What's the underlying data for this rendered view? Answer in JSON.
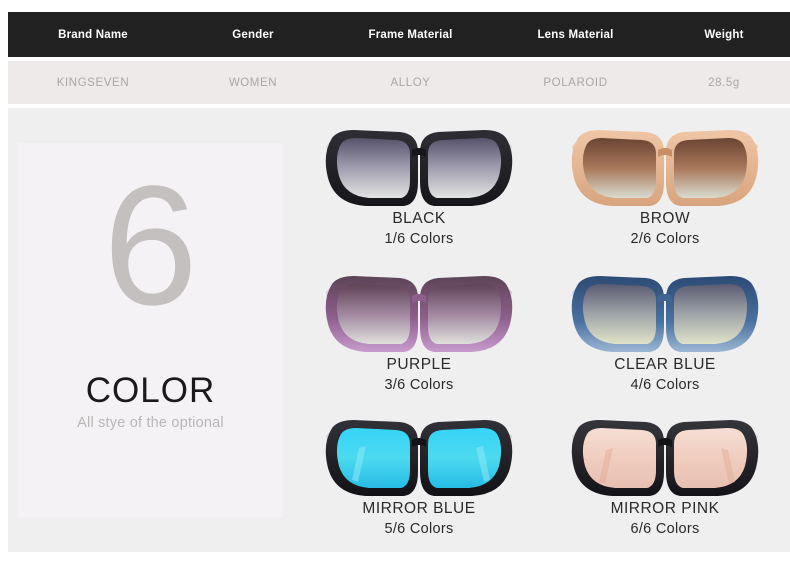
{
  "spec_table": {
    "headers": [
      "Brand Name",
      "Gender",
      "Frame Material",
      "Lens Material",
      "Weight"
    ],
    "values": [
      "KINGSEVEN",
      "WOMEN",
      "ALLOY",
      "POLAROID",
      "28.5g"
    ]
  },
  "color_panel": {
    "count": "6",
    "title": "COLOR",
    "subtitle": "All stye of the optional"
  },
  "products": [
    {
      "name": "BLACK",
      "count": "1/6  Colors",
      "frame_color": "#16161a",
      "frame_color_2": "#2e2e34",
      "lens_top": "#55526b",
      "lens_mid": "#9a97aa",
      "lens_bottom": "#e2e3e2",
      "temple_color": "#3a3a40"
    },
    {
      "name": "BROW",
      "count": "2/6  Colors",
      "frame_color": "#e8b997",
      "frame_color_2": "#d8a47e",
      "lens_top": "#6a4433",
      "lens_mid": "#a9775a",
      "lens_bottom": "#d9dccf",
      "temple_color": "#8d5b43"
    },
    {
      "name": "PURPLE",
      "count": "3/6  Colors",
      "frame_color": "#6d5264",
      "frame_color_2": "#b98ec0",
      "lens_top": "#5f4256",
      "lens_mid": "#a187a0",
      "lens_bottom": "#dfe0dc",
      "temple_color": "#6a4a60"
    },
    {
      "name": "CLEAR BLUE",
      "count": "4/6  Colors",
      "frame_color": "#2c4a74",
      "frame_color_2": "#7b9ec4",
      "lens_top": "#5b5b72",
      "lens_mid": "#9fa5a8",
      "lens_bottom": "#e0e2c8",
      "temple_color": "#445f83"
    },
    {
      "name": "MIRROR BLUE",
      "count": "5/6  Colors",
      "frame_color": "#121216",
      "frame_color_2": "#313138",
      "lens_top": "#2fd0f5",
      "lens_mid": "#46d8ef",
      "lens_bottom": "#2bbfe6",
      "temple_color": "#2a2a30"
    },
    {
      "name": "MIRROR PINK",
      "count": "6/6  Colors",
      "frame_color": "#141418",
      "frame_color_2": "#35353c",
      "lens_top": "#f2d8cd",
      "lens_mid": "#f0cdbf",
      "lens_bottom": "#eac4b6",
      "temple_color": "#2c2c32"
    }
  ]
}
